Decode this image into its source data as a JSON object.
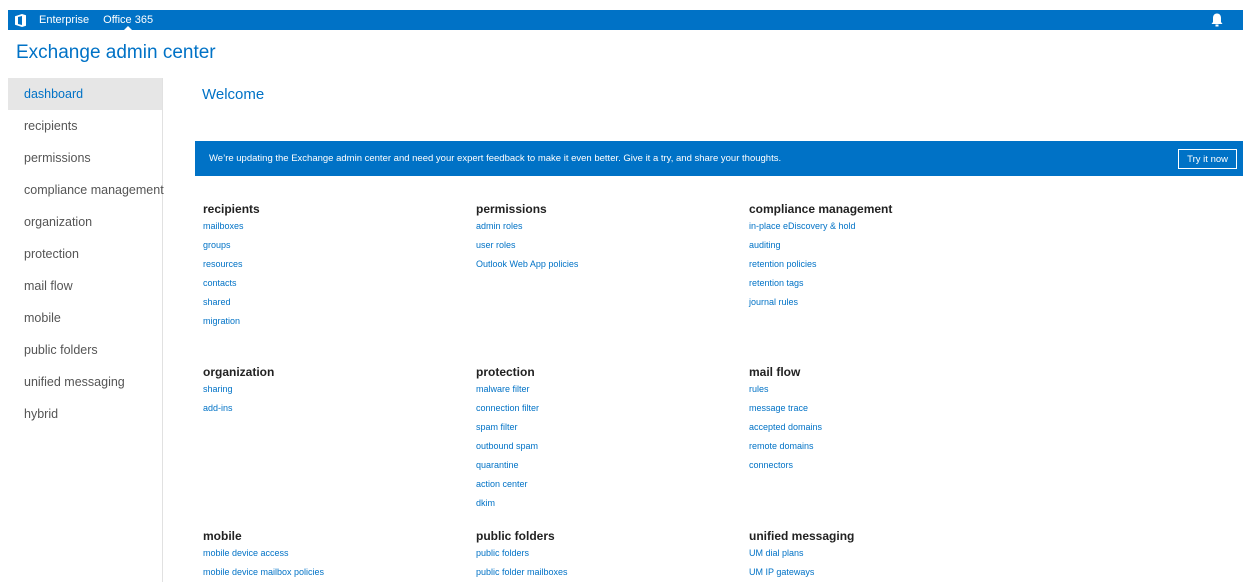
{
  "topbar": {
    "logo_icon": "office-logo-icon",
    "links": [
      "Enterprise",
      "Office 365"
    ],
    "bell_icon": "notification-bell-icon"
  },
  "app_title": "Exchange admin center",
  "sidebar": {
    "items": [
      {
        "label": "dashboard",
        "active": true
      },
      {
        "label": "recipients"
      },
      {
        "label": "permissions"
      },
      {
        "label": "compliance management"
      },
      {
        "label": "organization"
      },
      {
        "label": "protection"
      },
      {
        "label": "mail flow"
      },
      {
        "label": "mobile"
      },
      {
        "label": "public folders"
      },
      {
        "label": "unified messaging"
      },
      {
        "label": "hybrid"
      }
    ]
  },
  "main": {
    "welcome": "Welcome",
    "banner": {
      "text": "We’re updating the Exchange admin center and need your expert feedback to make it even better. Give it a try, and share your thoughts.",
      "button": "Try it now"
    },
    "sections": {
      "recipients": {
        "title": "recipients",
        "links": [
          "mailboxes",
          "groups",
          "resources",
          "contacts",
          "shared",
          "migration"
        ]
      },
      "permissions": {
        "title": "permissions",
        "links": [
          "admin roles",
          "user roles",
          "Outlook Web App policies"
        ]
      },
      "compliance": {
        "title": "compliance management",
        "links": [
          "in-place eDiscovery & hold",
          "auditing",
          "retention policies",
          "retention tags",
          "journal rules"
        ]
      },
      "organization": {
        "title": "organization",
        "links": [
          "sharing",
          "add-ins"
        ]
      },
      "protection": {
        "title": "protection",
        "links": [
          "malware filter",
          "connection filter",
          "spam filter",
          "outbound spam",
          "quarantine",
          "action center",
          "dkim"
        ]
      },
      "mailflow": {
        "title": "mail flow",
        "links": [
          "rules",
          "message trace",
          "accepted domains",
          "remote domains",
          "connectors"
        ]
      },
      "mobile": {
        "title": "mobile",
        "links": [
          "mobile device access",
          "mobile device mailbox policies"
        ]
      },
      "publicfolders": {
        "title": "public folders",
        "links": [
          "public folders",
          "public folder mailboxes"
        ]
      },
      "um": {
        "title": "unified messaging",
        "links": [
          "UM dial plans",
          "UM IP gateways"
        ]
      }
    }
  },
  "colors": {
    "accent": "#0072c6",
    "sidebar_active_bg": "#e6e6e6"
  }
}
